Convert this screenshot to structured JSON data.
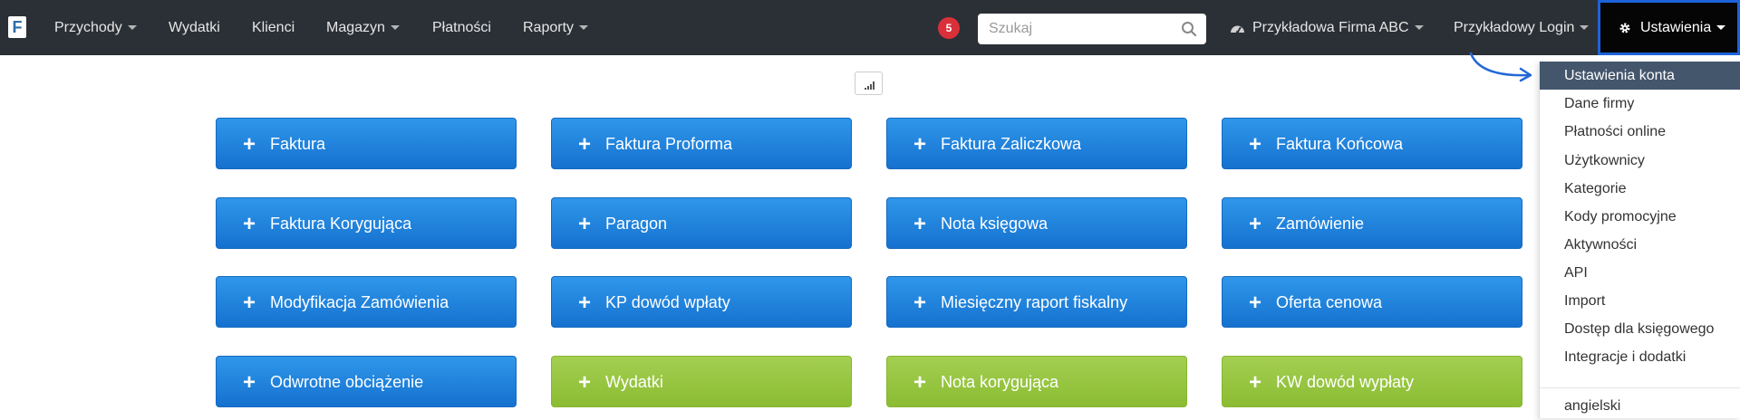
{
  "navbar": {
    "logo_letter": "F",
    "menu": [
      {
        "label": "Przychody",
        "dropdown": true
      },
      {
        "label": "Wydatki",
        "dropdown": false
      },
      {
        "label": "Klienci",
        "dropdown": false
      },
      {
        "label": "Magazyn",
        "dropdown": true
      },
      {
        "label": "Płatności",
        "dropdown": false
      },
      {
        "label": "Raporty",
        "dropdown": true
      }
    ],
    "notification_count": "5",
    "search": {
      "placeholder": "Szukaj",
      "value": ""
    },
    "company": "Przykładowa Firma ABC",
    "login": "Przykładowy Login",
    "settings": "Ustawienia"
  },
  "tiles": [
    {
      "label": "Faktura",
      "color": "blue"
    },
    {
      "label": "Faktura Proforma",
      "color": "blue"
    },
    {
      "label": "Faktura Zaliczkowa",
      "color": "blue"
    },
    {
      "label": "Faktura Końcowa",
      "color": "blue"
    },
    {
      "label": "Faktura Korygująca",
      "color": "blue"
    },
    {
      "label": "Paragon",
      "color": "blue"
    },
    {
      "label": "Nota księgowa",
      "color": "blue"
    },
    {
      "label": "Zamówienie",
      "color": "blue"
    },
    {
      "label": "Modyfikacja Zamówienia",
      "color": "blue"
    },
    {
      "label": "KP dowód wpłaty",
      "color": "blue"
    },
    {
      "label": "Miesięczny raport fiskalny",
      "color": "blue"
    },
    {
      "label": "Oferta cenowa",
      "color": "blue"
    },
    {
      "label": "Odwrotne obciążenie",
      "color": "blue"
    },
    {
      "label": "Wydatki",
      "color": "green"
    },
    {
      "label": "Nota korygująca",
      "color": "green"
    },
    {
      "label": "KW dowód wypłaty",
      "color": "green"
    }
  ],
  "settings_menu": {
    "items": [
      "Ustawienia konta",
      "Dane firmy",
      "Płatności online",
      "Użytkownicy",
      "Kategorie",
      "Kody promocyjne",
      "Aktywności",
      "API",
      "Import",
      "Dostęp dla księgowego",
      "Integracje i dodatki"
    ],
    "active_index": 0,
    "language": "angielski"
  },
  "colors": {
    "navbar_bg": "#2b3036",
    "tile_blue": "#1f84de",
    "tile_green": "#96c53e",
    "badge_red": "#d9303a",
    "highlight_border": "#1d62d9",
    "dropdown_active_bg": "#44566c"
  },
  "icons": {
    "plus": "+",
    "settings": "gear-icon",
    "company": "dashboard-icon",
    "search": "search-icon",
    "chart": "signal-bars-icon"
  }
}
